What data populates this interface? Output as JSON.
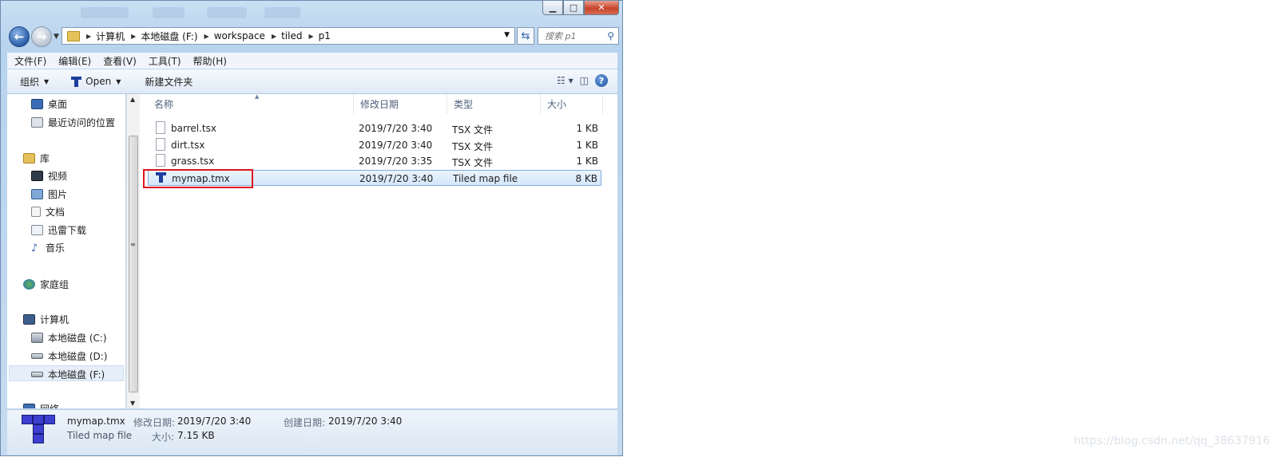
{
  "window": {
    "controls": {
      "minimize": "▁",
      "maximize": "□",
      "close": "✕"
    }
  },
  "address": {
    "crumbs": [
      "计算机",
      "本地磁盘 (F:)",
      "workspace",
      "tiled",
      "p1"
    ]
  },
  "search": {
    "placeholder": "搜索 p1"
  },
  "menu": [
    "文件(F)",
    "编辑(E)",
    "查看(V)",
    "工具(T)",
    "帮助(H)"
  ],
  "toolbar": {
    "organize": "组织",
    "open": "Open",
    "new_folder": "新建文件夹"
  },
  "nav": {
    "items": [
      "桌面",
      "最近访问的位置",
      "库",
      "视频",
      "图片",
      "文档",
      "迅雷下载",
      "音乐",
      "家庭组",
      "计算机",
      "本地磁盘 (C:)",
      "本地磁盘 (D:)",
      "本地磁盘 (F:)",
      "网络"
    ],
    "selected": "本地磁盘 (F:)"
  },
  "columns": [
    "名称",
    "修改日期",
    "类型",
    "大小"
  ],
  "files": [
    {
      "name": "barrel.tsx",
      "date": "2019/7/20 3:40",
      "type": "TSX 文件",
      "size": "1 KB"
    },
    {
      "name": "dirt.tsx",
      "date": "2019/7/20 3:40",
      "type": "TSX 文件",
      "size": "1 KB"
    },
    {
      "name": "grass.tsx",
      "date": "2019/7/20 3:35",
      "type": "TSX 文件",
      "size": "1 KB"
    },
    {
      "name": "mymap.tmx",
      "date": "2019/7/20 3:40",
      "type": "Tiled map file",
      "size": "8 KB"
    }
  ],
  "details": {
    "name": "mymap.tmx",
    "type": "Tiled map file",
    "modified_label": "修改日期:",
    "modified": "2019/7/20 3:40",
    "created_label": "创建日期:",
    "created": "2019/7/20 3:40",
    "size_label": "大小:",
    "size": "7.15 KB"
  },
  "watermark": "https://blog.csdn.net/qq_38637916",
  "colors": {
    "highlight_box": "#e0141e",
    "selection": "#d5e7fb",
    "accent": "#2b5ea8"
  }
}
